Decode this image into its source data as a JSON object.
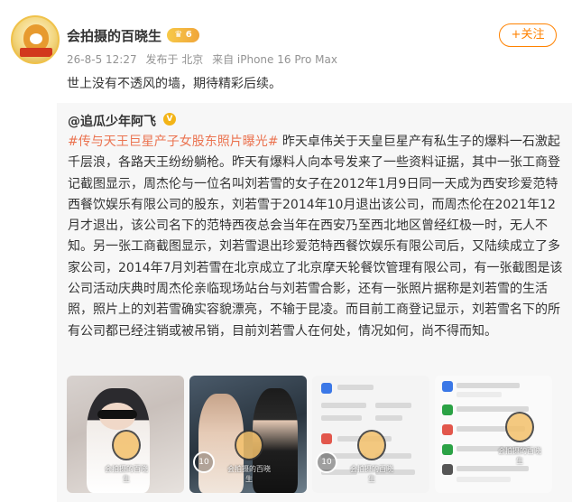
{
  "header": {
    "username": "会拍摄的百晓生",
    "vip_badge": "6",
    "timestamp": "26-8-5 12:27",
    "posted_from": "发布于 北京",
    "device": "来自 iPhone 16 Pro Max",
    "follow_label": "+关注"
  },
  "post": {
    "text": "世上没有不透风的墙，期待精彩后续。"
  },
  "repost": {
    "author": "@追瓜少年阿飞",
    "hashtag": "#传与天王巨星产子女股东照片曝光#",
    "body": " 昨天卓伟关于天皇巨星产有私生子的爆料一石激起千层浪，各路天王纷纷躺枪。昨天有爆料人向本号发来了一些资料证据，其中一张工商登记截图显示，周杰伦与一位名叫刘若雪的女子在2012年1月9日同一天成为西安珍爱范特西餐饮娱乐有限公司的股东，刘若雪于2014年10月退出该公司，而周杰伦在2021年12月才退出，该公司名下的范特西夜总会当年在西安乃至西北地区曾经红极一时，无人不知。另一张工商截图显示，刘若雪退出珍爱范特西餐饮娱乐有限公司后，又陆续成立了多家公司，2014年7月刘若雪在北京成立了北京摩天轮餐饮管理有限公司，有一张截图是该公司活动庆典时周杰伦亲临现场站台与刘若雪合影，还有一张照片据称是刘若雪的生活照，照片上的刘若雪确实容貌漂亮，不输于昆凌。而目前工商登记显示，刘若雪名下的所有公司都已经注销或被吊销，目前刘若雪人在何处，情况如何，尚不得而知。"
  },
  "thumbnails": [
    {
      "kind": "photo",
      "watermark": "会拍摄的百晓生"
    },
    {
      "kind": "photo",
      "watermark": "会拍摄的百晓生"
    },
    {
      "kind": "document",
      "watermark": "会拍摄的百晓生"
    },
    {
      "kind": "document",
      "watermark": "会拍摄的百晓生"
    }
  ],
  "colors": {
    "accent": "#ff8200",
    "hashtag": "#eb7350",
    "repost_bg": "#f7f7f7"
  }
}
